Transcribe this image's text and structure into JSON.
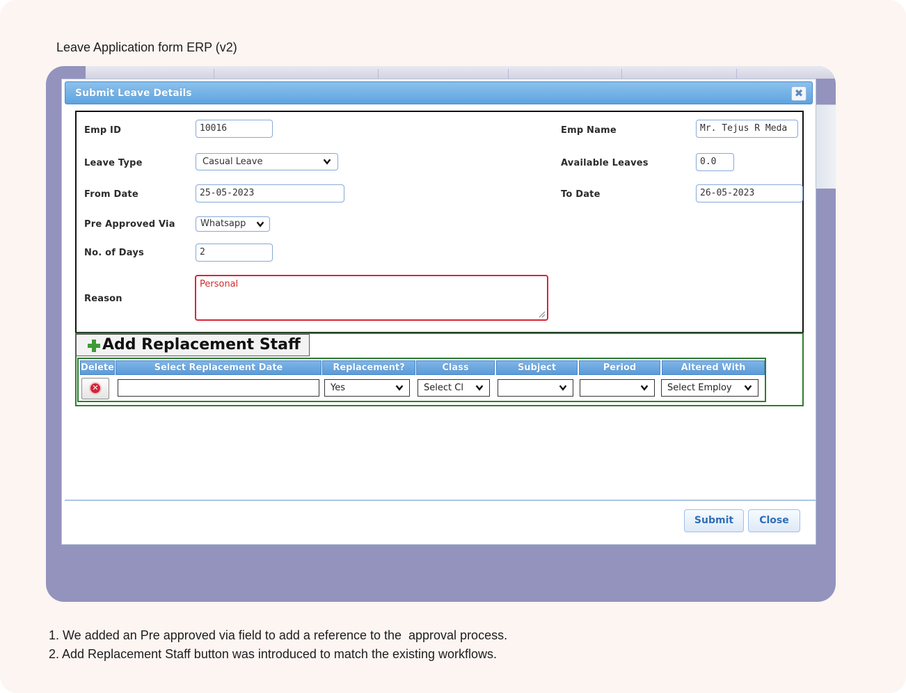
{
  "page_title": "Leave Application form ERP (v2)",
  "dialog": {
    "title": "Submit Leave Details",
    "close_icon": "close-icon",
    "fields": {
      "emp_id": {
        "label": "Emp ID",
        "value": "10016"
      },
      "emp_name": {
        "label": "Emp Name",
        "value": "Mr. Tejus R Meda"
      },
      "leave_type": {
        "label": "Leave Type",
        "value": "Casual Leave"
      },
      "available_leaves": {
        "label": "Available Leaves",
        "value": "0.0"
      },
      "from_date": {
        "label": "From Date",
        "value": "25-05-2023"
      },
      "to_date": {
        "label": "To Date",
        "value": "26-05-2023"
      },
      "pre_approved_via": {
        "label": "Pre Approved Via",
        "value": "Whatsapp"
      },
      "no_of_days": {
        "label": "No. of Days",
        "value": "2"
      },
      "reason": {
        "label": "Reason",
        "value": "Personal"
      }
    },
    "replacement": {
      "button_label": "Add Replacement Staff",
      "columns": [
        "Delete",
        "Select Replacement Date",
        "Replacement?",
        "Class",
        "Subject",
        "Period",
        "Altered With"
      ],
      "row": {
        "date": "",
        "replacement": "Yes",
        "class": "Select Cl",
        "subject": "",
        "period": "",
        "altered_with": "Select Employ"
      }
    },
    "buttons": {
      "submit": "Submit",
      "close": "Close"
    }
  },
  "notes": [
    "1. We added an Pre approved via field to add a reference to the  approval process.",
    "2. Add Replacement Staff button was introduced to match the existing workflows."
  ],
  "colors": {
    "backdrop": "#9393bd",
    "titlebar": "#6aaae2",
    "reason_border": "#d9253a",
    "replacement_border": "#2e7d2e",
    "button_text": "#2f6eb6"
  }
}
